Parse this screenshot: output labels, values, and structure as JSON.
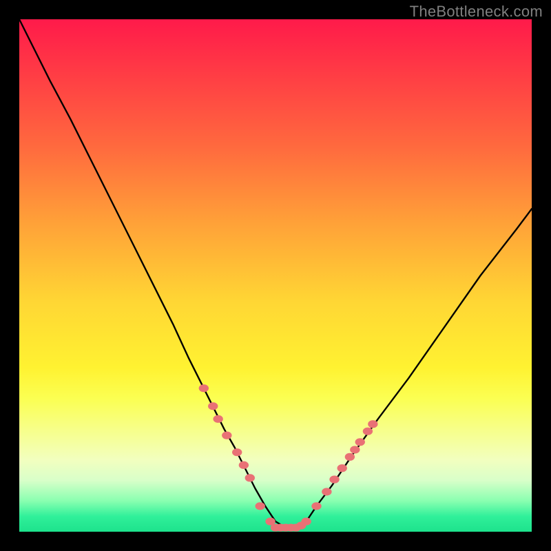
{
  "watermark": "TheBottleneck.com",
  "colors": {
    "curve": "#000000",
    "dots": "#e97175",
    "background_top": "#ff1a4a",
    "background_bottom": "#1de28c"
  },
  "chart_data": {
    "type": "line",
    "title": "",
    "xlabel": "",
    "ylabel": "",
    "xlim": [
      0,
      100
    ],
    "ylim": [
      0,
      100
    ],
    "series": [
      {
        "name": "bottleneck-curve",
        "x": [
          0,
          3,
          6,
          10,
          14,
          18,
          22,
          26,
          30,
          33,
          36,
          38,
          40,
          42,
          44,
          46,
          48,
          50,
          52,
          54,
          56,
          58,
          61,
          65,
          70,
          76,
          83,
          90,
          97,
          100
        ],
        "y": [
          100,
          94,
          88,
          80.5,
          72.5,
          64.5,
          56.5,
          48.5,
          40.5,
          34,
          28,
          24,
          20,
          16.5,
          12.5,
          8.5,
          5,
          2,
          0.8,
          0.8,
          2,
          5,
          9,
          15,
          22,
          30,
          40,
          50,
          59,
          63
        ]
      }
    ],
    "dot_clusters": [
      {
        "name": "left-cluster",
        "points": [
          {
            "x": 36.0,
            "y": 28.0
          },
          {
            "x": 37.8,
            "y": 24.5
          },
          {
            "x": 38.8,
            "y": 22.0
          },
          {
            "x": 40.5,
            "y": 18.8
          },
          {
            "x": 42.5,
            "y": 15.5
          },
          {
            "x": 43.8,
            "y": 13.0
          },
          {
            "x": 45.0,
            "y": 10.5
          },
          {
            "x": 47.0,
            "y": 5.0
          },
          {
            "x": 49.0,
            "y": 2.0
          }
        ]
      },
      {
        "name": "bottom-flat-cluster",
        "points": [
          {
            "x": 50.0,
            "y": 0.8
          },
          {
            "x": 51.0,
            "y": 0.8
          },
          {
            "x": 52.0,
            "y": 0.8
          },
          {
            "x": 53.0,
            "y": 0.8
          },
          {
            "x": 54.0,
            "y": 0.8
          },
          {
            "x": 55.0,
            "y": 1.2
          },
          {
            "x": 56.0,
            "y": 2.0
          }
        ]
      },
      {
        "name": "right-cluster",
        "points": [
          {
            "x": 58.0,
            "y": 5.0
          },
          {
            "x": 60.0,
            "y": 7.8
          },
          {
            "x": 61.5,
            "y": 10.2
          },
          {
            "x": 63.0,
            "y": 12.4
          },
          {
            "x": 64.5,
            "y": 14.6
          },
          {
            "x": 65.5,
            "y": 16.0
          },
          {
            "x": 66.5,
            "y": 17.5
          },
          {
            "x": 68.0,
            "y": 19.6
          },
          {
            "x": 69.0,
            "y": 21.0
          }
        ]
      }
    ]
  }
}
